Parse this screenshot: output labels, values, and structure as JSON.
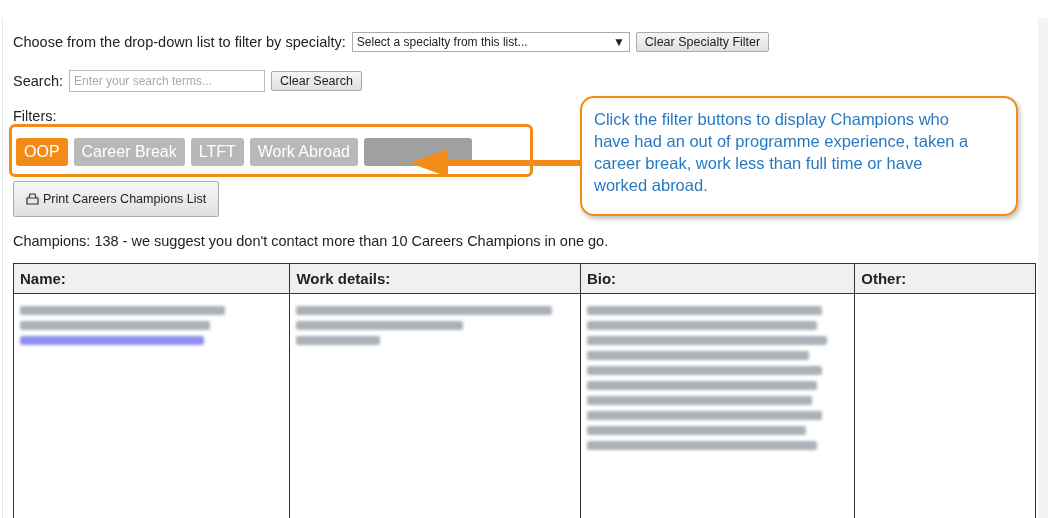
{
  "specialty_filter": {
    "label": "Choose from the drop-down list to filter by specialty:",
    "select_value": "Select a specialty from this list...",
    "select_arrow": "▼",
    "clear_button": "Clear Specialty Filter"
  },
  "search": {
    "label": "Search:",
    "placeholder": "Enter your search terms...",
    "clear_button": "Clear Search"
  },
  "filters": {
    "label": "Filters:",
    "buttons": [
      {
        "kind": "label",
        "label": "OOP",
        "selected": true
      },
      {
        "kind": "label",
        "label": "Career Break",
        "selected": false
      },
      {
        "kind": "label",
        "label": "LTFT",
        "selected": false
      },
      {
        "kind": "label",
        "label": "Work Abroad",
        "selected": false
      },
      {
        "kind": "obscured"
      }
    ]
  },
  "print_button": "Print Careers Champions List",
  "summary": "Champions: 138 - we suggest you don't contact more than 10 Careers Champions in one go.",
  "callout": "Click the filter buttons to display Champions who have had an out of programme experience, taken a career break, work less than full time or have worked abroad.",
  "table": {
    "columns": [
      "Name:",
      "Work details:",
      "Bio:",
      "Other:"
    ],
    "rows": [
      {
        "blurred": true
      }
    ]
  }
}
